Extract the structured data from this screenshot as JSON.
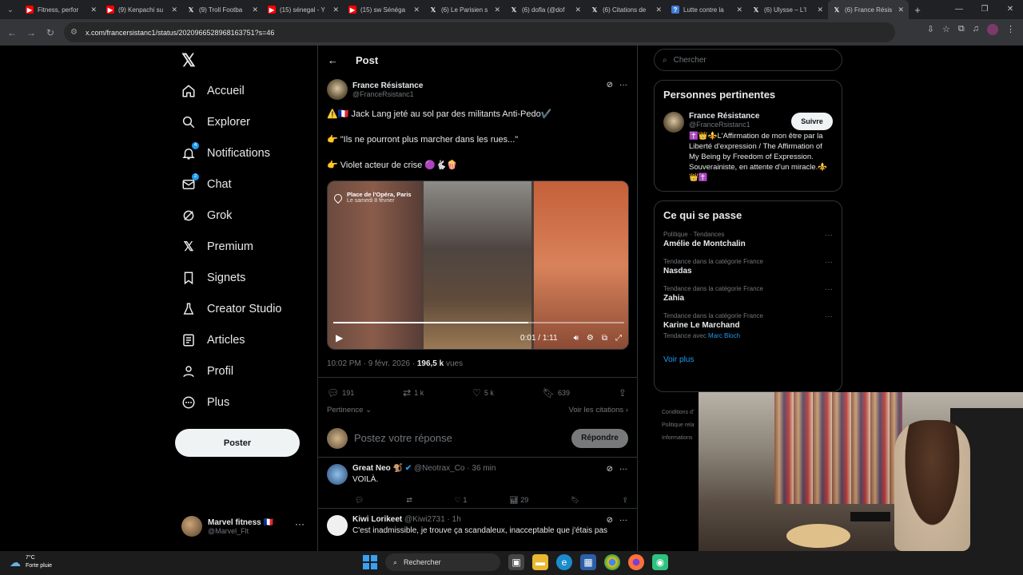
{
  "browser": {
    "tabs": [
      {
        "icon": "youtube-icon",
        "title": "Fitness, perfor"
      },
      {
        "icon": "youtube-icon",
        "title": "(9) Kenpachi su"
      },
      {
        "icon": "x-icon",
        "title": "(9) Troll Footba"
      },
      {
        "icon": "youtube-icon",
        "title": "(15) sénegal - Y"
      },
      {
        "icon": "youtube-icon",
        "title": "(15) sw Sénéga"
      },
      {
        "icon": "x-icon",
        "title": "(6) Le Parisien s"
      },
      {
        "icon": "x-icon",
        "title": "(6) dofla (@dof"
      },
      {
        "icon": "x-icon",
        "title": "(6) Citations de"
      },
      {
        "icon": "wiki-icon",
        "title": "Lutte contre la"
      },
      {
        "icon": "x-icon",
        "title": "(6) Ulysse – L'I"
      },
      {
        "icon": "x-icon",
        "title": "(6) France Résis"
      }
    ],
    "url": "x.com/francersistanc1/status/2020966528968163751?s=46"
  },
  "nav": {
    "items": [
      {
        "label": "Accueil",
        "icon": "home-icon"
      },
      {
        "label": "Explorer",
        "icon": "search-icon"
      },
      {
        "label": "Notifications",
        "icon": "bell-icon",
        "badge": "4"
      },
      {
        "label": "Chat",
        "icon": "mail-icon",
        "badge": "2"
      },
      {
        "label": "Grok",
        "icon": "grok-icon"
      },
      {
        "label": "Premium",
        "icon": "x-icon"
      },
      {
        "label": "Signets",
        "icon": "bookmark-icon"
      },
      {
        "label": "Creator Studio",
        "icon": "flask-icon"
      },
      {
        "label": "Articles",
        "icon": "article-icon"
      },
      {
        "label": "Profil",
        "icon": "person-icon"
      },
      {
        "label": "Plus",
        "icon": "more-circle-icon"
      }
    ],
    "post_button": "Poster",
    "account": {
      "name": "Marvel fitness 🇫🇷",
      "handle": "@Marvel_Flt"
    }
  },
  "header": {
    "title": "Post"
  },
  "post": {
    "author": "France Résistance",
    "handle": "@FranceRsistanc1",
    "lines": [
      "⚠️🇫🇷 Jack Lang jeté au sol par des militants Anti-Pedo✔️",
      "👉 \"Ils ne pourront plus marcher dans les rues...\"",
      "👉 Violet acteur de crise 🟣🐇🍿"
    ],
    "video": {
      "location": "Place de l'Opéra, Paris",
      "date": "Le samedi 8 février",
      "time": "0:01 / 1:11",
      "progress": 0.67
    },
    "timestamp": "10:02 PM · 9 févr. 2026 · ",
    "views": "196,5 k",
    "views_label": "vues",
    "stats": {
      "replies": "191",
      "reposts": "1 k",
      "likes": "5 k",
      "bookmarks": "639"
    },
    "sort_label": "Pertinence",
    "quotes_label": "Voir les citations"
  },
  "reply_box": {
    "placeholder": "Postez votre réponse",
    "button": "Répondre"
  },
  "comments": [
    {
      "name": "Great Neo 🐒",
      "handle": "@Neotrax_Co · 36 min",
      "text": "VOILÀ.",
      "likes": "1",
      "views": "29"
    },
    {
      "name": "Kiwi Lorikeet",
      "handle": "@Kiwi2731 · 1h",
      "text": "C'est inadmissible, je trouve ça scandaleux, inacceptable que j'étais pas",
      "likes": "",
      "views": ""
    }
  ],
  "sidebar": {
    "search_placeholder": "Chercher",
    "relevant_title": "Personnes pertinentes",
    "person": {
      "name": "France Résistance",
      "handle": "@FranceRsistanc1",
      "follow": "Suivre",
      "bio": "✝️👑⚜️L'Affirmation de mon être par la Liberté d'expression / The Affirmation of My Being by Freedom of Expression. Souverainiste, en attente d'un miracle.⚜️👑✝️"
    },
    "trends_title": "Ce qui se passe",
    "trends": [
      {
        "context": "Politique · Tendances",
        "name": "Amélie de Montchalin",
        "with_label": "",
        "with_link": ""
      },
      {
        "context": "Tendance dans la catégorie France",
        "name": "Nasdas",
        "with_label": "",
        "with_link": ""
      },
      {
        "context": "Tendance dans la catégorie France",
        "name": "Zahia",
        "with_label": "",
        "with_link": ""
      },
      {
        "context": "Tendance dans la catégorie France",
        "name": "Karine Le Marchand",
        "with_label": "Tendance avec ",
        "with_link": "Marc Bloch"
      }
    ],
    "more": "Voir plus",
    "footer": [
      "Conditions d'",
      "Politique rela",
      "Informations"
    ]
  },
  "taskbar": {
    "temp": "7°C",
    "weather": "Forte pluie",
    "search": "Rechercher"
  }
}
